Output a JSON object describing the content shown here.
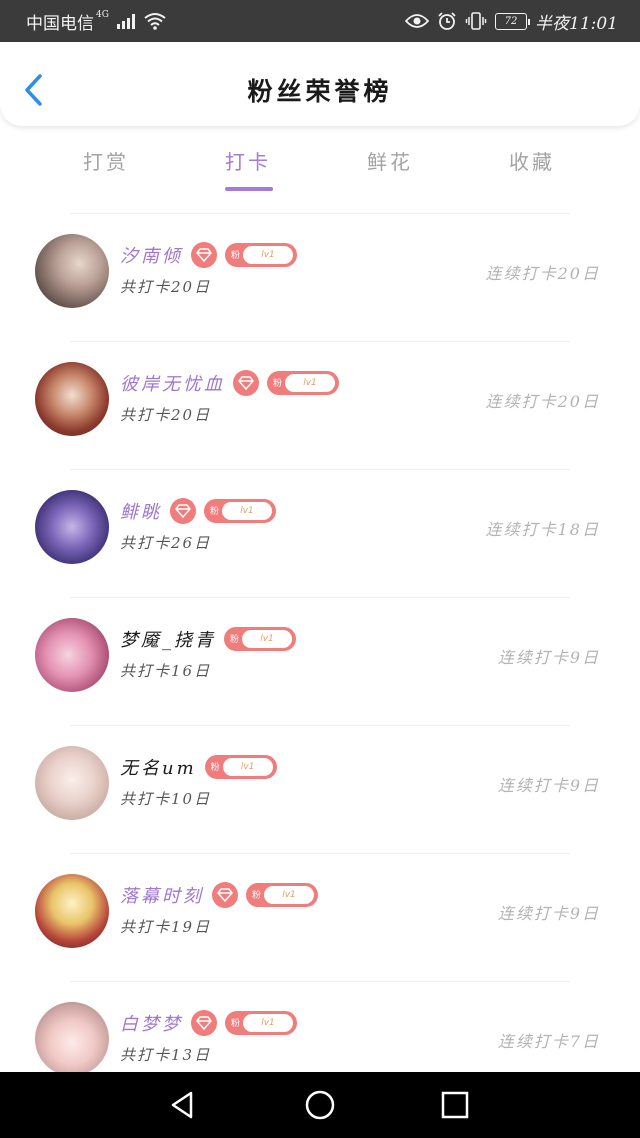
{
  "status_bar": {
    "carrier": "中国电信",
    "network": "4G",
    "battery": "72",
    "time": "半夜11:01"
  },
  "header": {
    "title": "粉丝荣誉榜"
  },
  "tabs": [
    {
      "label": "打赏"
    },
    {
      "label": "打卡"
    },
    {
      "label": "鲜花"
    },
    {
      "label": "收藏"
    }
  ],
  "active_tab": "打卡",
  "badge": {
    "fan_char": "粉",
    "level": "lv1"
  },
  "users": [
    {
      "name": "汐南倾",
      "total": "共打卡20日",
      "streak": "连续打卡20日",
      "diamond": true,
      "name_color": "#9f76d1"
    },
    {
      "name": "彼岸无忧血",
      "total": "共打卡20日",
      "streak": "连续打卡20日",
      "diamond": true,
      "name_color": "#9f76d1"
    },
    {
      "name": "鲱眺",
      "total": "共打卡26日",
      "streak": "连续打卡18日",
      "diamond": true,
      "name_color": "#9f76d1"
    },
    {
      "name": "梦魇_挠青",
      "total": "共打卡16日",
      "streak": "连续打卡9日",
      "diamond": false,
      "name_color": "#1a1a1a"
    },
    {
      "name": "无名um",
      "total": "共打卡10日",
      "streak": "连续打卡9日",
      "diamond": false,
      "name_color": "#1a1a1a"
    },
    {
      "name": "落幕时刻",
      "total": "共打卡19日",
      "streak": "连续打卡9日",
      "diamond": true,
      "name_color": "#9f76d1"
    },
    {
      "name": "白梦梦",
      "total": "共打卡13日",
      "streak": "连续打卡7日",
      "diamond": true,
      "name_color": "#9f76d1"
    }
  ],
  "colors": {
    "accent": "#a67bd6",
    "badge": "#f07c7c",
    "streak_text": "#b3b3b3"
  }
}
